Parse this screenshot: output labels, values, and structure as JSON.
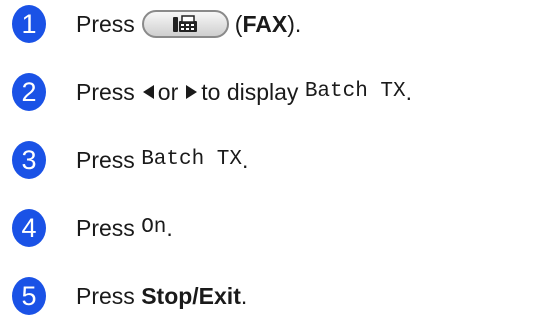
{
  "accent_color": "#1a52e6",
  "steps": [
    {
      "number": "1",
      "prefix": "Press",
      "button_icon": "fax-machine-icon",
      "paren_open": "(",
      "bold": "FAX",
      "paren_close": ")."
    },
    {
      "number": "2",
      "prefix": "Press",
      "left_icon": "left-triangle-icon",
      "or": "or",
      "right_icon": "right-triangle-icon",
      "mid": "to display",
      "mono": "Batch TX",
      "suffix": "."
    },
    {
      "number": "3",
      "prefix": "Press",
      "mono": "Batch TX",
      "suffix": "."
    },
    {
      "number": "4",
      "prefix": "Press",
      "mono": "On",
      "suffix": "."
    },
    {
      "number": "5",
      "prefix": "Press",
      "bold": "Stop/Exit",
      "suffix": "."
    }
  ]
}
